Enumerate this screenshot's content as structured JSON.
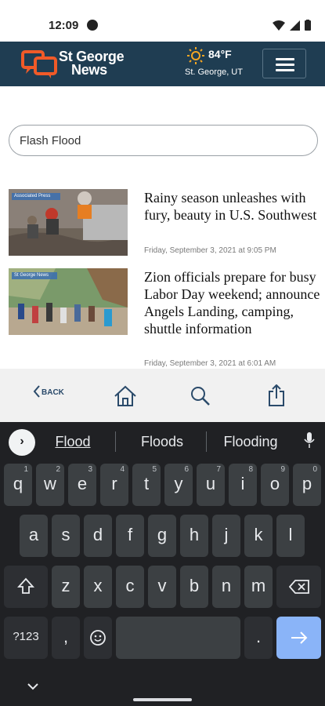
{
  "status_bar": {
    "time": "12:09"
  },
  "header": {
    "logo_line1": "St George",
    "logo_line2": "News",
    "weather_temp": "84°F",
    "weather_location": "St. George, UT",
    "accent_color": "#1f3d52",
    "logo_orange": "#f05a28"
  },
  "search": {
    "value": "Flash Flood"
  },
  "articles": [
    {
      "title": "Rainy season unleashes with fury, beauty in U.S. Southwest",
      "date": "Friday, September 3, 2021 at 9:05 PM",
      "image_badge": "Associated Press"
    },
    {
      "title": "Zion officials prepare for busy Labor Day weekend; announce Angels Landing, camping, shuttle information",
      "date": "Friday, September 3, 2021 at 6:01 AM",
      "image_badge": "St George News"
    }
  ],
  "bottom_nav": {
    "back_label": "BACK"
  },
  "keyboard": {
    "suggestions": [
      "Flood",
      "Floods",
      "Flooding"
    ],
    "row1": [
      {
        "k": "q",
        "s": "1"
      },
      {
        "k": "w",
        "s": "2"
      },
      {
        "k": "e",
        "s": "3"
      },
      {
        "k": "r",
        "s": "4"
      },
      {
        "k": "t",
        "s": "5"
      },
      {
        "k": "y",
        "s": "6"
      },
      {
        "k": "u",
        "s": "7"
      },
      {
        "k": "i",
        "s": "8"
      },
      {
        "k": "o",
        "s": "9"
      },
      {
        "k": "p",
        "s": "0"
      }
    ],
    "row2": [
      "a",
      "s",
      "d",
      "f",
      "g",
      "h",
      "j",
      "k",
      "l"
    ],
    "row3": [
      "z",
      "x",
      "c",
      "v",
      "b",
      "n",
      "m"
    ],
    "symbols_label": "?123",
    "comma": ",",
    "period": "."
  }
}
